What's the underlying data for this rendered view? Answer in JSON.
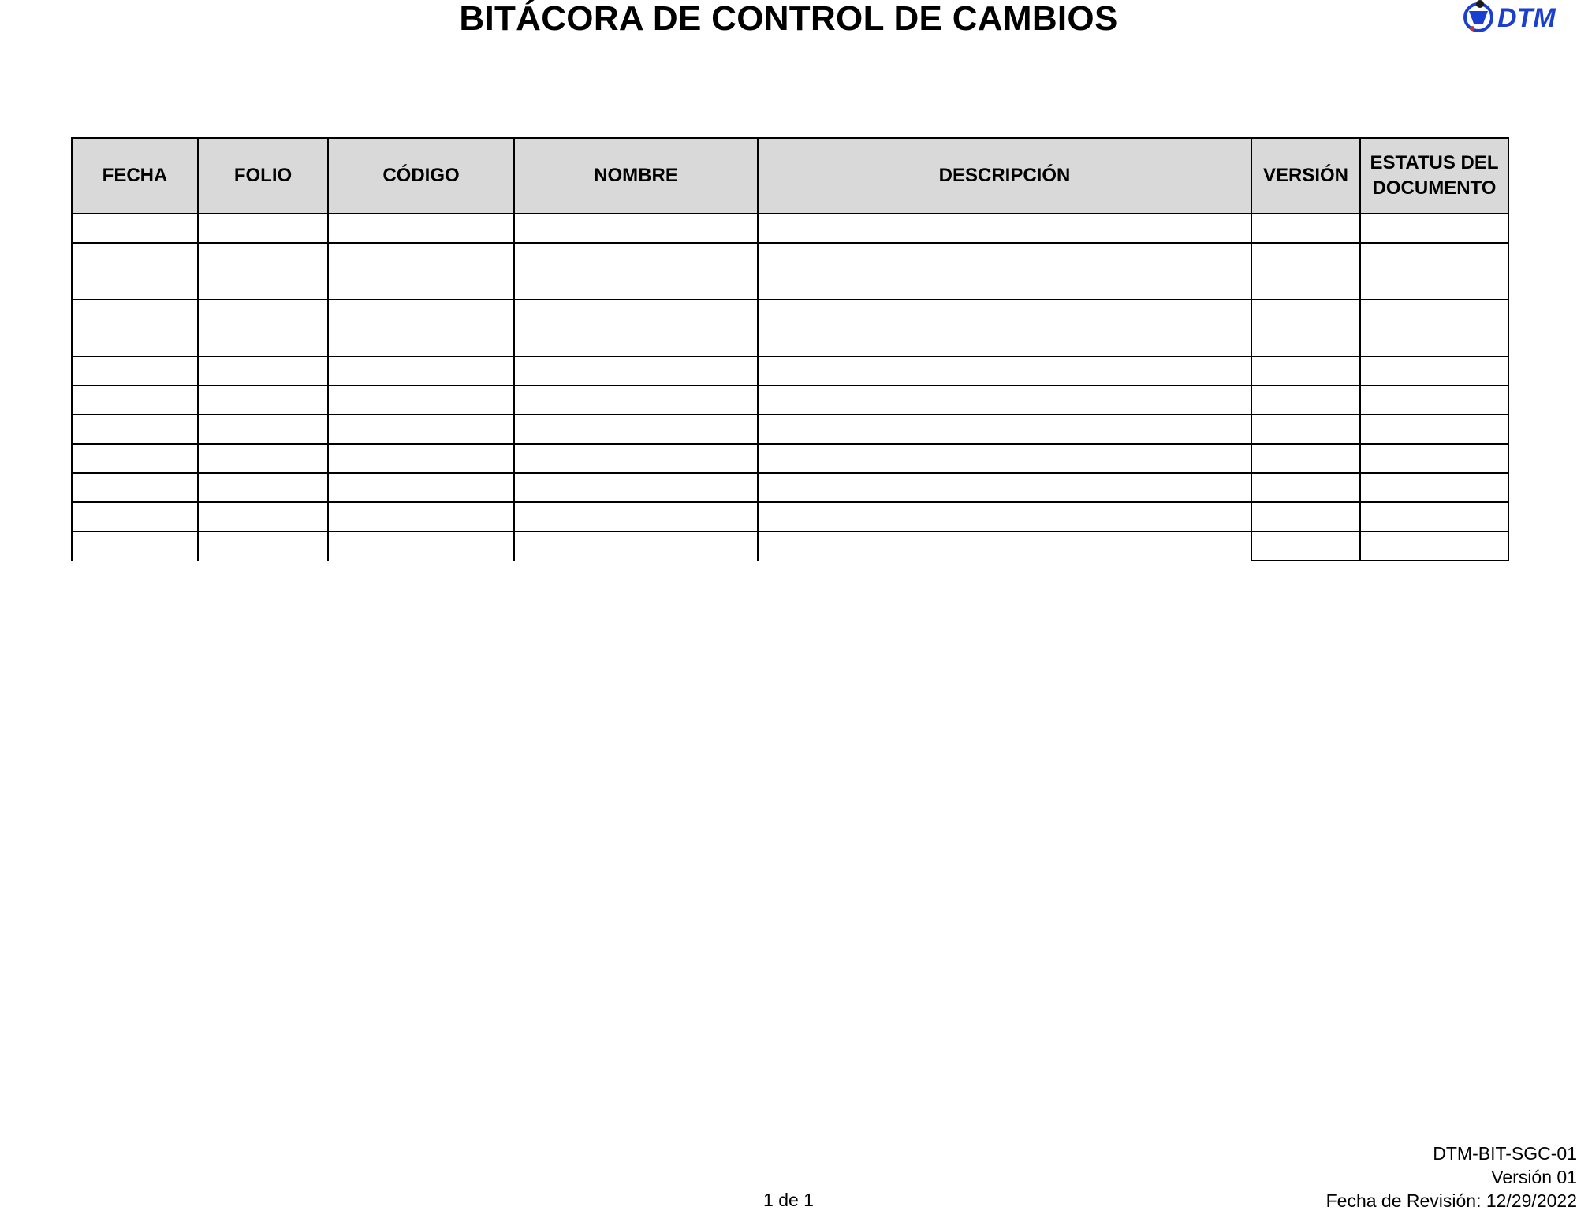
{
  "header": {
    "title": "BITÁCORA DE CONTROL DE CAMBIOS",
    "logo_text": "DTM",
    "logo_color": "#1a3fd0"
  },
  "table": {
    "columns": [
      "FECHA",
      "FOLIO",
      "CÓDIGO",
      "NOMBRE",
      "DESCRIPCIÓN",
      "VERSIÓN",
      "ESTATUS DEL DOCUMENTO"
    ],
    "header_background": "#d9d9d9",
    "rows": [
      [
        "",
        "",
        "",
        "",
        "",
        "",
        ""
      ],
      [
        "",
        "",
        "",
        "",
        "",
        "",
        ""
      ],
      [
        "",
        "",
        "",
        "",
        "",
        "",
        ""
      ],
      [
        "",
        "",
        "",
        "",
        "",
        "",
        ""
      ],
      [
        "",
        "",
        "",
        "",
        "",
        "",
        ""
      ],
      [
        "",
        "",
        "",
        "",
        "",
        "",
        ""
      ],
      [
        "",
        "",
        "",
        "",
        "",
        "",
        ""
      ],
      [
        "",
        "",
        "",
        "",
        "",
        "",
        ""
      ],
      [
        "",
        "",
        "",
        "",
        "",
        "",
        ""
      ],
      [
        "",
        "",
        "",
        "",
        "",
        "",
        ""
      ]
    ]
  },
  "footer": {
    "page": "1 de 1",
    "doc_code": "DTM-BIT-SGC-01",
    "version": "Versión 01",
    "revision_date": "Fecha de Revisión: 12/29/2022"
  }
}
